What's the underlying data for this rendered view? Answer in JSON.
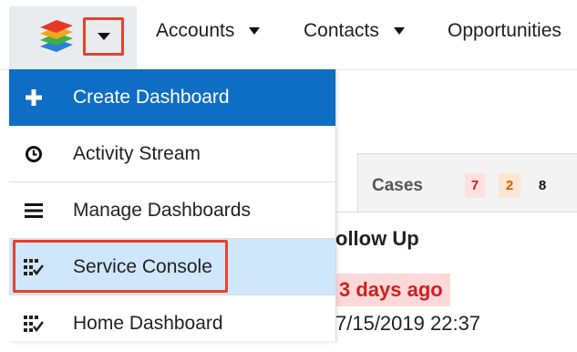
{
  "nav": {
    "items": [
      {
        "label": "Accounts"
      },
      {
        "label": "Contacts"
      },
      {
        "label": "Opportunities"
      }
    ]
  },
  "menu": {
    "items": [
      {
        "label": "Create Dashboard",
        "icon": "plus-icon"
      },
      {
        "label": "Activity Stream",
        "icon": "clock-icon"
      },
      {
        "label": "Manage Dashboards",
        "icon": "list-icon"
      },
      {
        "label": "Service Console",
        "icon": "dashboard-check-icon"
      },
      {
        "label": "Home Dashboard",
        "icon": "dashboard-check-icon"
      }
    ]
  },
  "background": {
    "tab_label": "Cases",
    "badges": [
      "7",
      "2",
      "8"
    ],
    "column_header": "ollow Up",
    "overdue_text": "3 days ago",
    "date_text": "7/15/2019 22:37"
  },
  "colors": {
    "accent": "#0e6dc4",
    "highlight_row": "#cfe6fb",
    "annotation_red": "#e8412c"
  }
}
